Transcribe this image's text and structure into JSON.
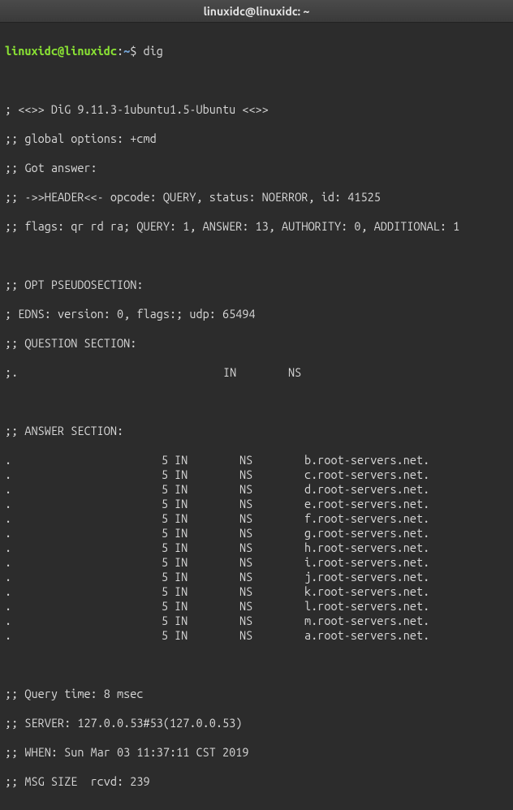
{
  "titlebar": "linuxidc@linuxidc: ~",
  "prompt": {
    "user": "linuxidc@linuxidc",
    "sep1": ":",
    "path": "~",
    "sep2": "$ "
  },
  "command": "dig",
  "header": {
    "version": "; <<>> DiG 9.11.3-1ubuntu1.5-Ubuntu <<>>",
    "global_options": ";; global options: +cmd",
    "got_answer": ";; Got answer:",
    "hdr": ";; ->>HEADER<<- opcode: QUERY, status: NOERROR, id: 41525",
    "flags": ";; flags: qr rd ra; QUERY: 1, ANSWER: 13, AUTHORITY: 0, ADDITIONAL: 1"
  },
  "opt": {
    "title": ";; OPT PSEUDOSECTION:",
    "edns": "; EDNS: version: 0, flags:; udp: 65494"
  },
  "question": {
    "title": ";; QUESTION SECTION:",
    "row": {
      "name": ";.",
      "in": "IN",
      "ns": "NS"
    }
  },
  "answer": {
    "title": ";; ANSWER SECTION:",
    "rows": [
      {
        "name": ".",
        "ttl": "5",
        "in": "IN",
        "ns": "NS",
        "host": "b.root-servers.net."
      },
      {
        "name": ".",
        "ttl": "5",
        "in": "IN",
        "ns": "NS",
        "host": "c.root-servers.net."
      },
      {
        "name": ".",
        "ttl": "5",
        "in": "IN",
        "ns": "NS",
        "host": "d.root-servers.net."
      },
      {
        "name": ".",
        "ttl": "5",
        "in": "IN",
        "ns": "NS",
        "host": "e.root-servers.net."
      },
      {
        "name": ".",
        "ttl": "5",
        "in": "IN",
        "ns": "NS",
        "host": "f.root-servers.net."
      },
      {
        "name": ".",
        "ttl": "5",
        "in": "IN",
        "ns": "NS",
        "host": "g.root-servers.net."
      },
      {
        "name": ".",
        "ttl": "5",
        "in": "IN",
        "ns": "NS",
        "host": "h.root-servers.net."
      },
      {
        "name": ".",
        "ttl": "5",
        "in": "IN",
        "ns": "NS",
        "host": "i.root-servers.net."
      },
      {
        "name": ".",
        "ttl": "5",
        "in": "IN",
        "ns": "NS",
        "host": "j.root-servers.net."
      },
      {
        "name": ".",
        "ttl": "5",
        "in": "IN",
        "ns": "NS",
        "host": "k.root-servers.net."
      },
      {
        "name": ".",
        "ttl": "5",
        "in": "IN",
        "ns": "NS",
        "host": "l.root-servers.net."
      },
      {
        "name": ".",
        "ttl": "5",
        "in": "IN",
        "ns": "NS",
        "host": "m.root-servers.net."
      },
      {
        "name": ".",
        "ttl": "5",
        "in": "IN",
        "ns": "NS",
        "host": "a.root-servers.net."
      }
    ]
  },
  "footer": {
    "query_time": ";; Query time: 8 msec",
    "server": ";; SERVER: 127.0.0.53#53(127.0.0.53)",
    "when": ";; WHEN: Sun Mar 03 11:37:11 CST 2019",
    "msg_size": ";; MSG SIZE  rcvd: 239"
  }
}
